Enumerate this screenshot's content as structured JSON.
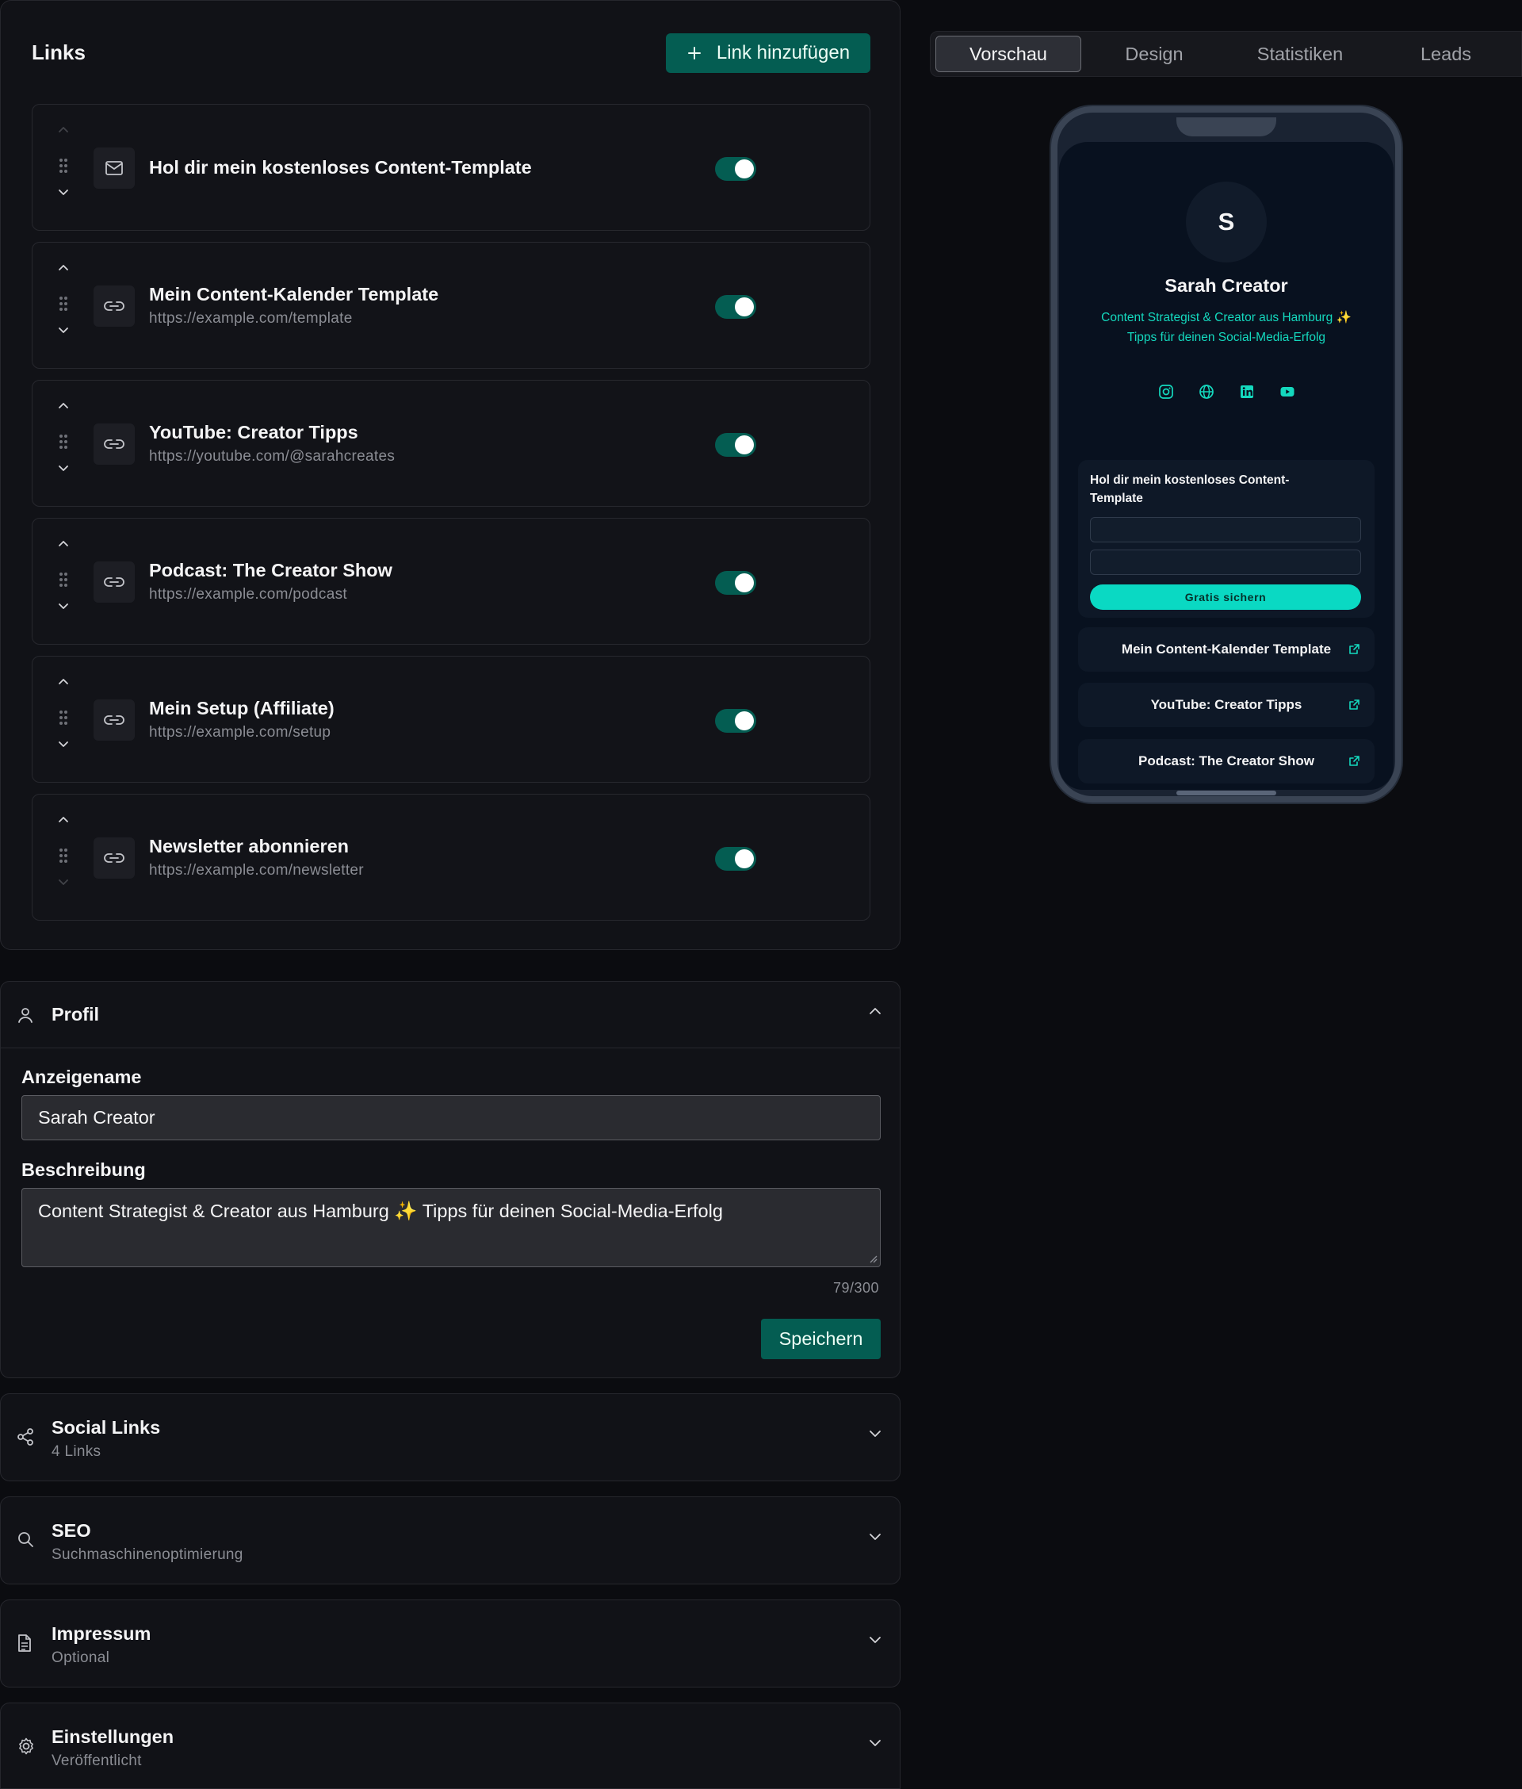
{
  "links_section": {
    "title": "Links",
    "add_button_label": "Link hinzufügen",
    "items": [
      {
        "title": "Hol dir mein kostenloses Content-Template",
        "url": "",
        "icon": "mail-icon",
        "enabled": true
      },
      {
        "title": "Mein Content-Kalender Template",
        "url": "https://example.com/template",
        "icon": "link-icon",
        "enabled": true
      },
      {
        "title": "YouTube: Creator Tipps",
        "url": "https://youtube.com/@sarahcreates",
        "icon": "link-icon",
        "enabled": true
      },
      {
        "title": "Podcast: The Creator Show",
        "url": "https://example.com/podcast",
        "icon": "link-icon",
        "enabled": true
      },
      {
        "title": "Mein Setup (Affiliate)",
        "url": "https://example.com/setup",
        "icon": "link-icon",
        "enabled": true
      },
      {
        "title": "Newsletter abonnieren",
        "url": "https://example.com/newsletter",
        "icon": "link-icon",
        "enabled": true
      }
    ]
  },
  "profile": {
    "title": "Profil",
    "display_name_label": "Anzeigename",
    "display_name_value": "Sarah Creator",
    "description_label": "Beschreibung",
    "description_value": "Content Strategist & Creator aus Hamburg ✨ Tipps für deinen Social-Media-Erfolg",
    "char_count": "79/300",
    "save_label": "Speichern"
  },
  "sections": [
    {
      "title": "Social Links",
      "subtitle": "4 Links",
      "icon": "share-icon"
    },
    {
      "title": "SEO",
      "subtitle": "Suchmaschinenoptimierung",
      "icon": "search-icon"
    },
    {
      "title": "Impressum",
      "subtitle": "Optional",
      "icon": "document-icon"
    },
    {
      "title": "Einstellungen",
      "subtitle": "Veröffentlicht",
      "icon": "gear-icon"
    }
  ],
  "tabs": [
    {
      "label": "Vorschau",
      "active": true
    },
    {
      "label": "Design",
      "active": false
    },
    {
      "label": "Statistiken",
      "active": false
    },
    {
      "label": "Leads",
      "active": false
    }
  ],
  "preview": {
    "avatar_letter": "S",
    "name": "Sarah Creator",
    "bio_line1": "Content Strategist & Creator aus Hamburg ✨",
    "bio_line2": "Tipps für deinen Social-Media-Erfolg",
    "social_icons": [
      "instagram-icon",
      "globe-icon",
      "linkedin-icon",
      "youtube-icon"
    ],
    "lead_form_title": "Hol dir mein kostenloses Content-Template",
    "lead_button": "Gratis sichern",
    "links": [
      "Mein Content-Kalender Template",
      "YouTube: Creator Tipps",
      "Podcast: The Creator Show"
    ]
  },
  "colors": {
    "accent": "#045d52",
    "preview_accent": "#0ad9c3",
    "background": "#0b0c10",
    "card": "#111217"
  }
}
